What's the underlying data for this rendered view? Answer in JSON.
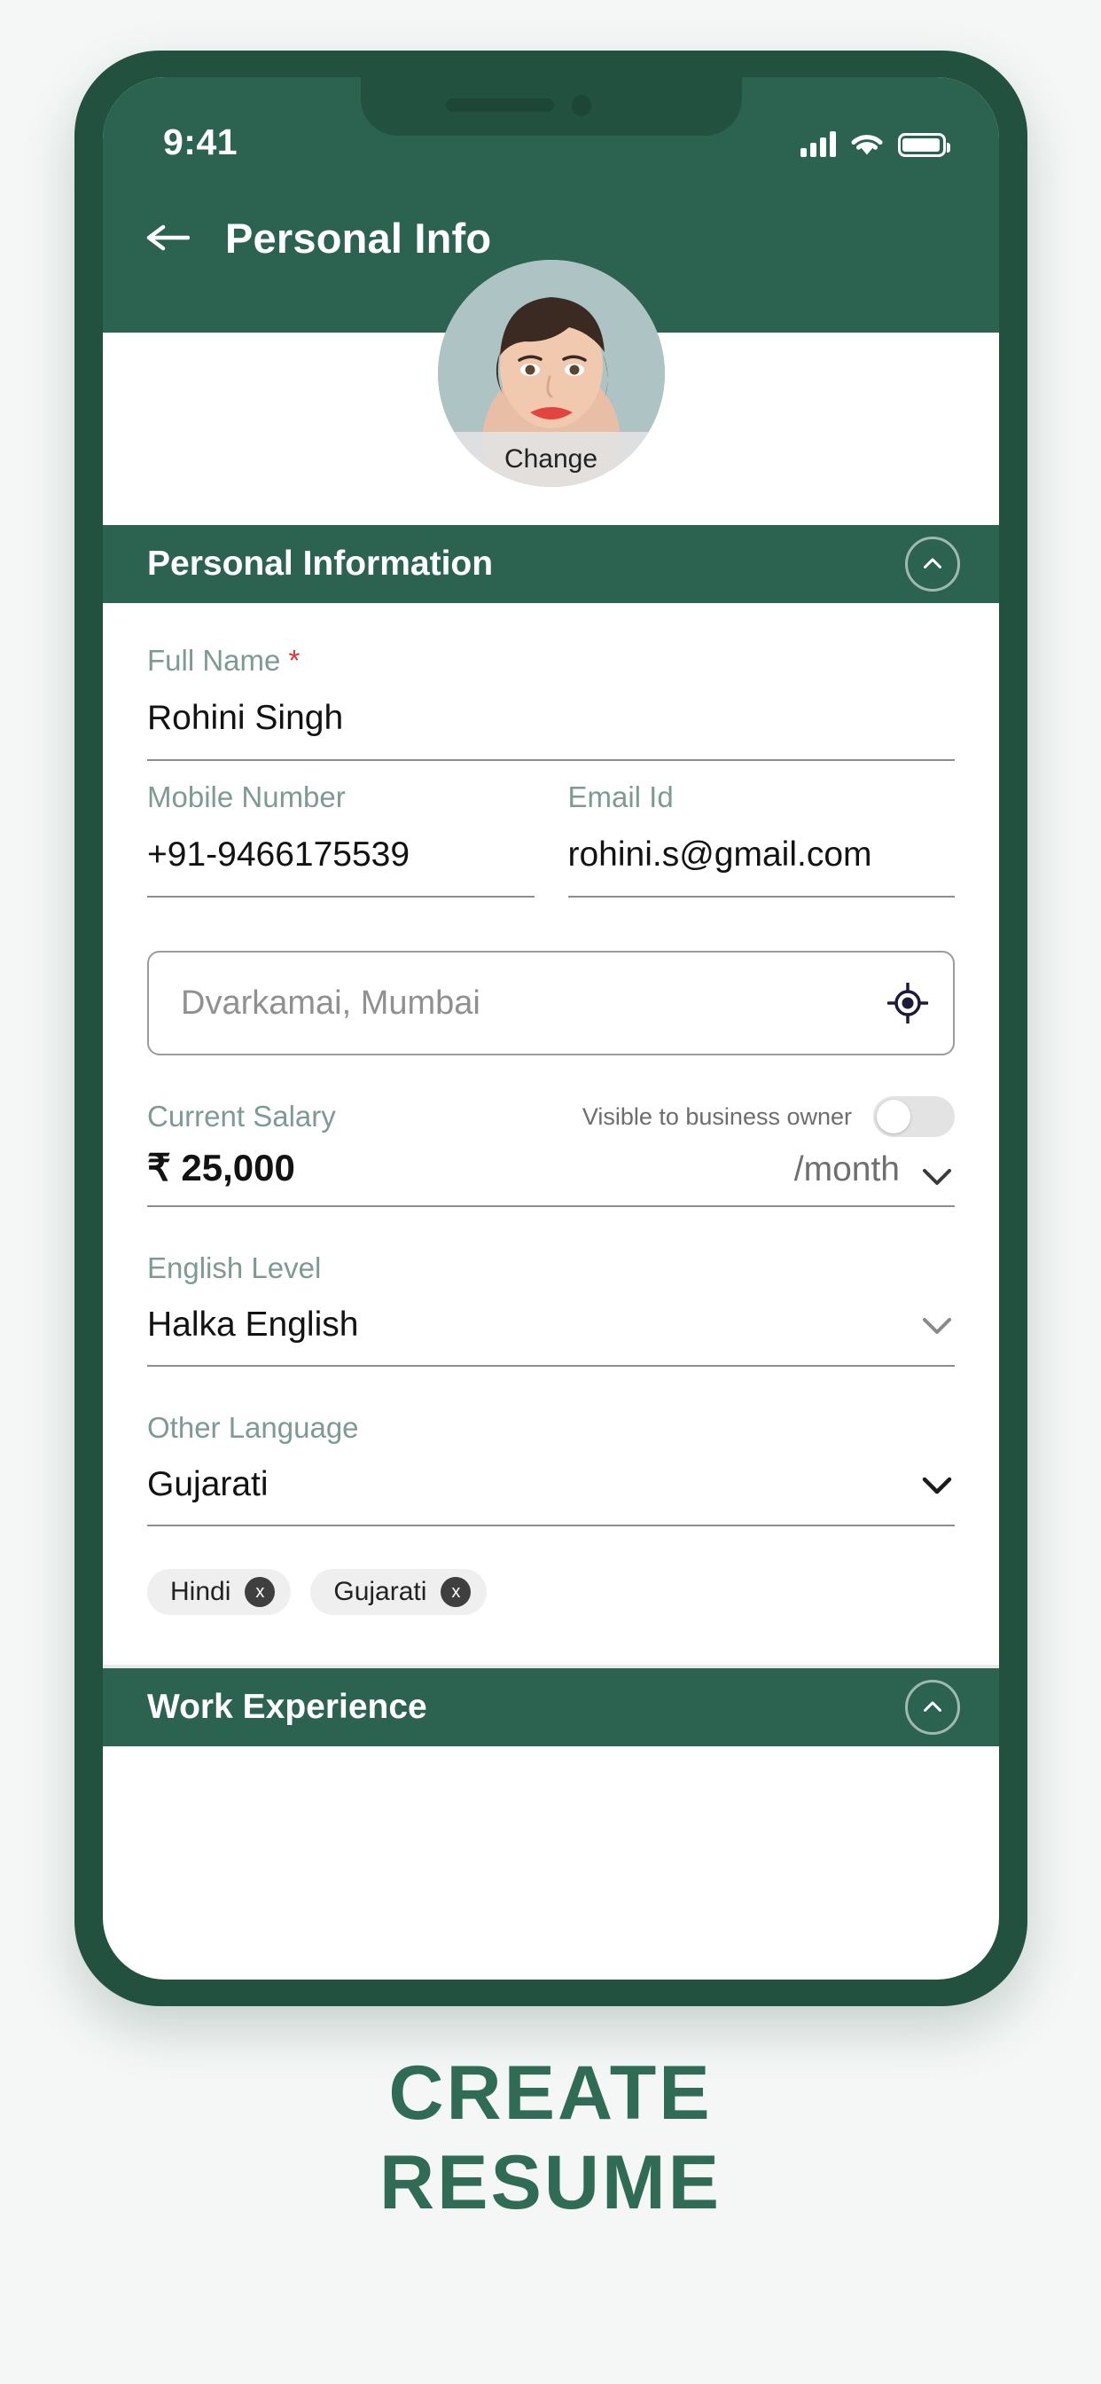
{
  "status_bar": {
    "time": "9:41",
    "icons": [
      "signal-bars-icon",
      "wifi-icon",
      "battery-icon"
    ]
  },
  "header": {
    "back_icon": "back-arrow-icon",
    "title": "Personal Info"
  },
  "avatar": {
    "icon": "user-avatar-photo",
    "change_label": "Change"
  },
  "sections": {
    "personal": {
      "title": "Personal Information",
      "collapse_icon": "chevron-up-icon"
    },
    "work": {
      "title": "Work Experience",
      "collapse_icon": "chevron-up-icon"
    }
  },
  "form": {
    "full_name": {
      "label": "Full Name",
      "required_marker": "*",
      "value": "Rohini Singh"
    },
    "mobile": {
      "label": "Mobile Number",
      "value": "+91-9466175539"
    },
    "email": {
      "label": "Email Id",
      "value": "rohini.s@gmail.com"
    },
    "location": {
      "placeholder": "Dvarkamai, Mumbai",
      "value": "",
      "gps_icon": "gps-locate-icon"
    },
    "salary": {
      "label": "Current Salary",
      "amount": "₹ 25,000",
      "unit": "/month",
      "unit_caret_icon": "chevron-down-icon",
      "toggle_label": "Visible to business owner",
      "toggle_state": "off"
    },
    "english_level": {
      "label": "English Level",
      "value": "Halka English",
      "caret_icon": "chevron-down-icon"
    },
    "other_language": {
      "label": "Other Language",
      "value": "Gujarati",
      "caret_icon": "chevron-down-icon"
    },
    "language_chips": [
      {
        "label": "Hindi",
        "remove_icon": "x"
      },
      {
        "label": "Gujarati",
        "remove_icon": "x"
      }
    ]
  },
  "caption": {
    "line1": "CREATE",
    "line2": "RESUME"
  },
  "colors": {
    "brand_green": "#2c6350",
    "bezel_green": "#22513f",
    "label_green": "#7d9b8f",
    "required_red": "#e53030",
    "caption_green": "#2f6b55"
  }
}
